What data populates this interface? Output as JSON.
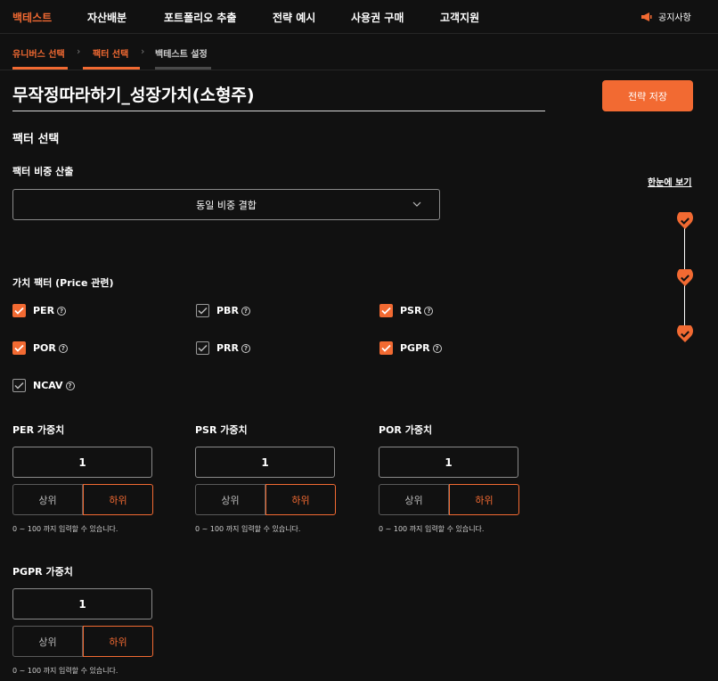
{
  "nav": {
    "items": [
      {
        "label": "백테스트",
        "active": true
      },
      {
        "label": "자산배분",
        "active": false
      },
      {
        "label": "포트폴리오 추출",
        "active": false
      },
      {
        "label": "전략 예시",
        "active": false
      },
      {
        "label": "사용권 구매",
        "active": false
      },
      {
        "label": "고객지원",
        "active": false
      }
    ],
    "notice_label": "공지사항"
  },
  "steps": {
    "items": [
      {
        "label": "유니버스 선택",
        "state": "done"
      },
      {
        "label": "팩터 선택",
        "state": "done"
      },
      {
        "label": "백테스트 설정",
        "state": "current"
      }
    ]
  },
  "strategy": {
    "title": "무작정따라하기_성장가치(소형주)",
    "save_label": "전략 저장"
  },
  "factor_section": {
    "heading": "팩터 선택",
    "weight_calc_label": "팩터 비중 산출",
    "weight_calc_value": "동일 비중 결합"
  },
  "side": {
    "overview_label": "한눈에 보기",
    "timeline_steps": 3
  },
  "value_factors": {
    "heading": "가치 팩터 (Price 관련)",
    "items": [
      {
        "label": "PER",
        "checked": true
      },
      {
        "label": "PBR",
        "checked": false
      },
      {
        "label": "PSR",
        "checked": true
      },
      {
        "label": "POR",
        "checked": true
      },
      {
        "label": "PRR",
        "checked": false
      },
      {
        "label": "PGPR",
        "checked": true
      },
      {
        "label": "NCAV",
        "checked": false
      }
    ],
    "help_glyph": "?"
  },
  "weights": {
    "upper_label": "상위",
    "lower_label": "하위",
    "hint": "0 ~ 100 까지 입력할 수 있습니다.",
    "items": [
      {
        "label": "PER 가중치",
        "value": "1",
        "selected": "lower"
      },
      {
        "label": "PSR 가중치",
        "value": "1",
        "selected": "lower"
      },
      {
        "label": "POR 가중치",
        "value": "1",
        "selected": "lower"
      },
      {
        "label": "PGPR 가중치",
        "value": "1",
        "selected": "lower"
      }
    ]
  },
  "colors": {
    "accent": "#f26a32",
    "background": "#111111"
  }
}
